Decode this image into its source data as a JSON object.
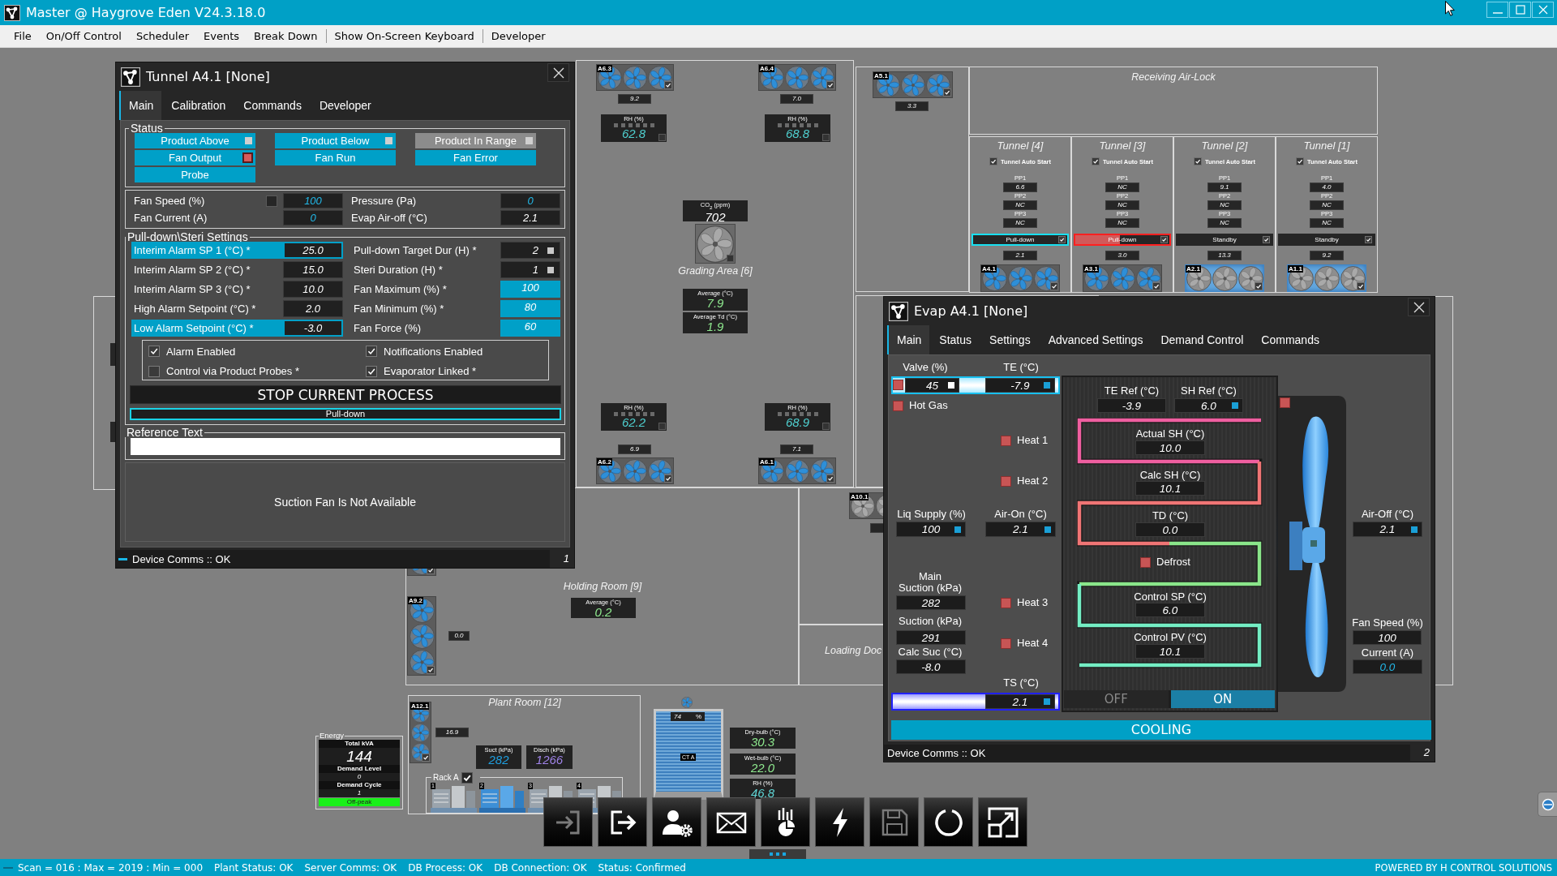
{
  "window": {
    "title": "Master @ Haygrove Eden V24.3.18.0"
  },
  "menu": [
    [
      "File",
      "On/Off Control",
      "Scheduler",
      "Events",
      "Break Down"
    ],
    [
      "Show On-Screen Keyboard"
    ],
    [
      "Developer"
    ]
  ],
  "plan": {
    "rooms": [
      {
        "name": "Receiving Air-Lock"
      },
      {
        "name": "Grading Area [6]"
      },
      {
        "name": "Holding Room [9]"
      },
      {
        "name": "Loading Doc"
      },
      {
        "name": "Plant Room [12]"
      }
    ],
    "fan_units": [
      {
        "tag": "A6.3",
        "reading": "9.2",
        "running": true,
        "checked": true
      },
      {
        "tag": "A6.4",
        "reading": "7.0",
        "running": true,
        "checked": true
      },
      {
        "tag": "A5.1",
        "reading": "3.3",
        "running": true,
        "checked": true
      },
      {
        "tag": "A6.2",
        "reading": "6.9",
        "running": true,
        "checked": true
      },
      {
        "tag": "A6.1",
        "reading": "7.1",
        "running": true,
        "checked": true
      },
      {
        "tag": "A10.1",
        "running": false
      },
      {
        "tag": "A9.2",
        "reading": "0.0",
        "running": true,
        "checked": true
      },
      {
        "tag": "A12.1",
        "reading": "16.9",
        "running": true,
        "checked": true
      },
      {
        "running": true,
        "checked": true
      }
    ],
    "rh_sensors": [
      {
        "label": "RH (%)",
        "value": "62.8"
      },
      {
        "label": "RH (%)",
        "value": "68.8"
      },
      {
        "label": "RH (%)",
        "value": "62.2"
      },
      {
        "label": "RH (%)",
        "value": "68.9"
      }
    ],
    "co2": {
      "label": "CO$_{2}$ (ppm)",
      "value": "702",
      "fan_running": false
    },
    "averages": [
      {
        "label": "Average (°C)",
        "value": "7.9"
      },
      {
        "label": "Average Td (°C)",
        "value": "1.9"
      },
      {
        "label": "Average (°C)",
        "value": "0.2"
      }
    ],
    "tunnels": [
      {
        "name": "Tunnel [4]",
        "auto_start": {
          "label": "Tunnel Auto Start",
          "checked": true
        },
        "probes": [
          {
            "label": "PP1",
            "value": "6.6"
          },
          {
            "label": "PP2",
            "value": "NC"
          },
          {
            "label": "PP3",
            "value": "NC"
          }
        ],
        "status": {
          "label": "Pull-down",
          "kind": "active",
          "checked": true
        },
        "reading": "2.1",
        "fan": {
          "tag": "A4.1",
          "running": true,
          "standby": false,
          "checked": true
        }
      },
      {
        "name": "Tunnel [3]",
        "auto_start": {
          "label": "Tunnel Auto Start",
          "checked": true
        },
        "probes": [
          {
            "label": "PP1",
            "value": "NC"
          },
          {
            "label": "PP2",
            "value": "NC"
          },
          {
            "label": "PP3",
            "value": "NC"
          }
        ],
        "status": {
          "label": "Pull-down",
          "kind": "alarm",
          "level": 0.47,
          "checked": true
        },
        "reading": "3.0",
        "fan": {
          "tag": "A3.1",
          "running": true,
          "standby": false,
          "checked": true
        }
      },
      {
        "name": "Tunnel [2]",
        "auto_start": {
          "label": "Tunnel Auto Start",
          "checked": true
        },
        "probes": [
          {
            "label": "PP1",
            "value": "9.1"
          },
          {
            "label": "PP2",
            "value": "NC"
          },
          {
            "label": "PP3",
            "value": "NC"
          }
        ],
        "status": {
          "label": "Standby",
          "kind": "idle",
          "checked": true
        },
        "reading": "13.3",
        "fan": {
          "tag": "A2.1",
          "running": false,
          "standby": true,
          "checked": true
        }
      },
      {
        "name": "Tunnel [1]",
        "auto_start": {
          "label": "Tunnel Auto Start",
          "checked": true
        },
        "probes": [
          {
            "label": "PP1",
            "value": "4.0"
          },
          {
            "label": "PP2",
            "value": "NC"
          },
          {
            "label": "PP3",
            "value": "NC"
          }
        ],
        "status": {
          "label": "Standby",
          "kind": "idle",
          "checked": true
        },
        "reading": "9.2",
        "fan": {
          "tag": "A1.1",
          "running": false,
          "standby": true,
          "checked": true
        }
      }
    ],
    "energy": {
      "title": "Energy",
      "rows": [
        {
          "label": "Total kVA",
          "value": "144"
        },
        {
          "label": "Demand Level",
          "value": "0"
        },
        {
          "label": "Demand Cycle",
          "value": "1"
        }
      ],
      "tariff": {
        "label": "Off-peak",
        "kind": "off_peak"
      }
    },
    "gauges": [
      {
        "label": "Suct (kPa)",
        "value": "282",
        "kind": "suction"
      },
      {
        "label": "Disch (kPa)",
        "value": "1266",
        "kind": "discharge"
      }
    ],
    "rack": {
      "label": "Rack A",
      "checked": true,
      "compressors": [
        {
          "number": "1",
          "running": false
        },
        {
          "number": "2",
          "running": true
        },
        {
          "number": "3",
          "running": false
        },
        {
          "number": "4",
          "running": false
        }
      ]
    },
    "cooling_tower": {
      "name": "CT A",
      "reading": "74",
      "unit": "%",
      "fan_running": true
    },
    "weather": [
      {
        "label": "Dry-bulb (°C)",
        "value": "30.3",
        "kind": "temperature"
      },
      {
        "label": "Wet-bulb (°C)",
        "value": "22.0",
        "kind": "temperature"
      },
      {
        "label": "RH (%)",
        "value": "46.8",
        "kind": "humidity"
      }
    ]
  },
  "toolbar": [
    {
      "kind": "login",
      "disabled": true
    },
    {
      "kind": "logout",
      "disabled": false
    },
    {
      "kind": "user_settings",
      "disabled": false
    },
    {
      "kind": "mail",
      "disabled": false
    },
    {
      "kind": "chart",
      "disabled": false
    },
    {
      "kind": "power",
      "disabled": false
    },
    {
      "kind": "save",
      "disabled": true
    },
    {
      "kind": "refresh",
      "disabled": false
    },
    {
      "kind": "resize",
      "disabled": false
    }
  ],
  "tunnel_dialog": {
    "title": "Tunnel A4.1 [None]",
    "tabs": [
      {
        "label": "Main",
        "selected": true
      },
      {
        "label": "Calibration",
        "selected": false
      },
      {
        "label": "Commands",
        "selected": false
      },
      {
        "label": "Developer",
        "selected": false
      }
    ],
    "status": {
      "title": "Status",
      "items": [
        {
          "label": "Product Above",
          "on": true,
          "lit": false
        },
        {
          "label": "Product Below",
          "on": true,
          "lit": false
        },
        {
          "label": "Product In Range",
          "on": false,
          "lit": false
        },
        {
          "label": "Fan Output",
          "on": true,
          "lit": true
        },
        {
          "label": "Fan Run",
          "on": true
        },
        {
          "label": "Fan Error",
          "on": true
        },
        {
          "label": "Probe",
          "on": true
        }
      ]
    },
    "readings": [
      {
        "label": "Fan Speed (%)",
        "value": "100",
        "kind": "measured",
        "checked": false
      },
      {
        "label": "Pressure (Pa)",
        "value": "0",
        "kind": "measured"
      },
      {
        "label": "Fan Current (A)",
        "value": "0",
        "kind": "measured"
      },
      {
        "label": "Evap Air-off (°C)",
        "value": "2.1",
        "kind": "linked"
      }
    ],
    "settings": {
      "title": "Pull-down\\Steri Settings",
      "items": [
        {
          "label": "Interim Alarm SP 1 (°C) *",
          "value": "25.0",
          "kind": "plain",
          "highlighted": true
        },
        {
          "label": "Pull-down Target Dur (H) *",
          "value": "2",
          "kind": "flag",
          "highlighted": false
        },
        {
          "label": "Interim Alarm SP 2 (°C) *",
          "value": "15.0",
          "kind": "plain",
          "highlighted": false
        },
        {
          "label": "Steri Duration (H) *",
          "value": "1",
          "kind": "flag",
          "highlighted": false
        },
        {
          "label": "Interim Alarm SP 3 (°C) *",
          "value": "10.0",
          "kind": "plain",
          "highlighted": false
        },
        {
          "label": "Fan Maximum (%) *",
          "value": "100",
          "kind": "accent",
          "highlighted": false
        },
        {
          "label": "High Alarm Setpoint (°C) *",
          "value": "2.0",
          "kind": "plain",
          "highlighted": false
        },
        {
          "label": "Fan Minimum (%) *",
          "value": "80",
          "kind": "accent",
          "highlighted": false
        },
        {
          "label": "Low Alarm Setpoint (°C) *",
          "value": "-3.0",
          "kind": "plain",
          "highlighted": true
        },
        {
          "label": "Fan Force (%)",
          "value": "60",
          "kind": "accent",
          "highlighted": false
        }
      ],
      "options": [
        {
          "label": "Alarm Enabled",
          "checked": true
        },
        {
          "label": "Notifications Enabled",
          "checked": true
        },
        {
          "label": "Control via Product Probes *",
          "checked": false
        },
        {
          "label": "Evaporator Linked *",
          "checked": true
        }
      ],
      "stop_button": "STOP CURRENT PROCESS",
      "process": "Pull-down"
    },
    "reference": {
      "title": "Reference Text"
    },
    "message": "Suction Fan Is Not Available",
    "footer": {
      "text": "Device Comms :: OK",
      "number": "1"
    }
  },
  "evap_dialog": {
    "title": "Evap A4.1 [None]",
    "tabs": [
      {
        "label": "Main",
        "selected": true
      },
      {
        "label": "Status",
        "selected": false
      },
      {
        "label": "Settings",
        "selected": false
      },
      {
        "label": "Advanced Settings",
        "selected": false
      },
      {
        "label": "Demand Control",
        "selected": false
      },
      {
        "label": "Commands",
        "selected": false
      }
    ],
    "fields": [
      {
        "label": "Valve (%)",
        "value": "45",
        "kind": "plain",
        "marker": {
          "color": "#ffffff"
        }
      },
      {
        "label": "TE (°C)",
        "value": "-7.9",
        "kind": "plain",
        "marker": {
          "color": "#1a9fd6"
        }
      },
      {
        "label": "Liq Supply (%)",
        "value": "100",
        "kind": "plain",
        "marker": {
          "color": "#1a9fd6"
        }
      },
      {
        "label": "Air-On (°C)",
        "value": "2.1",
        "kind": "plain",
        "marker": {
          "color": "#1a9fd6"
        }
      },
      {
        "label": "Main\nSuction (kPa)",
        "value": "282",
        "kind": "plain"
      },
      {
        "label": "Suction (kPa)",
        "value": "291",
        "kind": "plain"
      },
      {
        "label": "Calc Suc (°C)",
        "value": "-8.0",
        "kind": "plain"
      },
      {
        "label": "TS (°C)",
        "value": "2.1",
        "kind": "plain",
        "marker": {
          "color": "#1a9fd6"
        }
      },
      {
        "label": "TE Ref (°C)",
        "value": "-3.9",
        "kind": "plain"
      },
      {
        "label": "SH Ref (°C)",
        "value": "6.0",
        "kind": "plain",
        "marker": {
          "color": "#1a9fd6"
        }
      },
      {
        "label": "Actual SH (°C)",
        "value": "10.0",
        "kind": "plain"
      },
      {
        "label": "Calc SH (°C)",
        "value": "10.1",
        "kind": "plain"
      },
      {
        "label": "TD (°C)",
        "value": "0.0",
        "kind": "plain"
      },
      {
        "label": "Control SP (°C)",
        "value": "6.0",
        "kind": "plain"
      },
      {
        "label": "Control PV (°C)",
        "value": "10.1",
        "kind": "plain"
      },
      {
        "label": "Air-Off (°C)",
        "value": "2.1",
        "kind": "plain",
        "marker": {
          "color": "#1a9fd6"
        }
      },
      {
        "label": "Fan Speed (%)",
        "value": "100",
        "kind": "plain"
      },
      {
        "label": "Current (A)",
        "value": "0.0",
        "kind": "measured"
      }
    ],
    "indicators": [
      {
        "on": false
      },
      {
        "label": "Hot Gas",
        "on": false
      },
      {
        "label": "Heat 1",
        "on": false
      },
      {
        "label": "Heat 2",
        "on": false
      },
      {
        "label": "Heat 3",
        "on": false
      },
      {
        "label": "Heat 4",
        "on": false
      },
      {
        "label": "Defrost",
        "on": false
      },
      {
        "on": false
      }
    ],
    "switch": [
      {
        "label": "OFF",
        "selected": false
      },
      {
        "label": "ON",
        "selected": true
      }
    ],
    "mode": "COOLING",
    "footer": {
      "text": "Device Comms :: OK",
      "number": "2"
    }
  },
  "status_bar": {
    "items": [
      "Scan = 016 : Max = 2019 : Min = 000",
      "Plant Status: OK",
      "Server Comms: OK",
      "DB Process: OK",
      "DB Connection: OK",
      "Status: Confirmed"
    ],
    "credit": "POWERED BY H CONTROL SOLUTIONS"
  }
}
